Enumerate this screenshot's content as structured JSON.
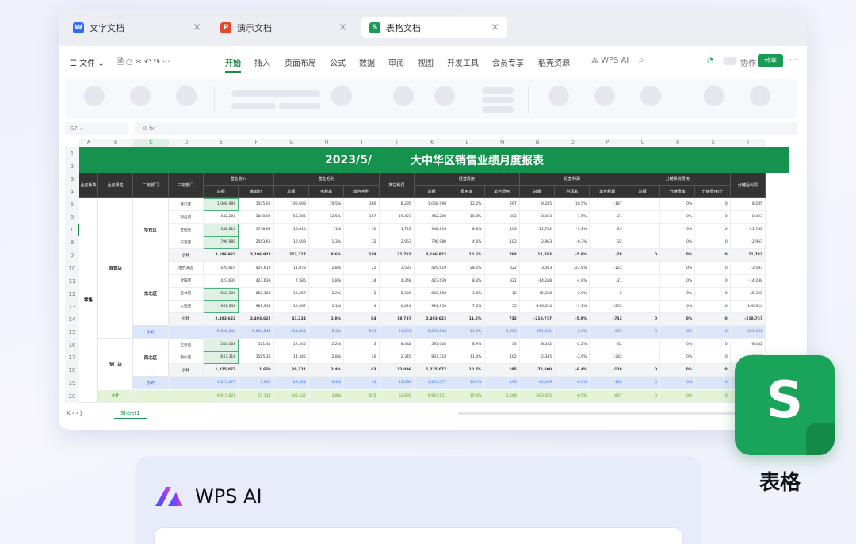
{
  "tabs": [
    {
      "icon": "W",
      "label": "文字文档",
      "color": "#2f6ef5"
    },
    {
      "icon": "P",
      "label": "演示文档",
      "color": "#e5472a"
    },
    {
      "icon": "S",
      "label": "表格文档",
      "color": "#1a9a55"
    }
  ],
  "toolbar": {
    "file": "☰ 文件 ⌄",
    "quick": "🗎  ⎙  ✂  ↶  ↷  ···",
    "menus": [
      "开始",
      "插入",
      "页面布局",
      "公式",
      "数据",
      "审阅",
      "视图",
      "开发工具",
      "会员专享",
      "稻壳资源"
    ],
    "wps_ai": "⟁ WPS AI",
    "collab": "协作",
    "share": "分享"
  },
  "formula_bar": {
    "name_box": "G7  ⌄",
    "fx": "⊖  fx"
  },
  "columns": [
    "A",
    "B",
    "C",
    "D",
    "E",
    "F",
    "G",
    "H",
    "I",
    "J",
    "K",
    "L",
    "M",
    "N",
    "O",
    "P",
    "Q",
    "R",
    "S",
    "T"
  ],
  "rows": [
    "1",
    "2",
    "3",
    "4",
    "5",
    "6",
    "7",
    "8",
    "9",
    "10",
    "11",
    "12",
    "13",
    "14",
    "15",
    "16",
    "17",
    "18",
    "19",
    "20"
  ],
  "report": {
    "date": "2023/5/",
    "title": "大中华区销售业绩月度报表",
    "headers_row3": [
      "业务板块",
      "业务属性",
      "二级部门",
      "三级部门",
      "营业收入",
      "营业毛利",
      "其它利润",
      "经营费用",
      "经营利润",
      "分摊系统费用",
      "分摊后利润"
    ],
    "headers_row4": [
      "总额",
      "客单价",
      "总额",
      "毛利率",
      "单台毛利",
      "总额",
      "费用率",
      "单台费用",
      "总额",
      "利润率",
      "单台利润",
      "总额",
      "分摊费率",
      "分摊费用/个"
    ],
    "segment": "零售",
    "attr1": "直营店",
    "attr2": "专门店",
    "dept_east": "华东区",
    "dept_northeast": "东北区",
    "dept_northwest": "西北区",
    "subtotal": "小计",
    "data_rows": [
      {
        "store": "厦门店",
        "v": [
          "1,008,998",
          "1505.00",
          "190,693",
          "19.5%",
          "300",
          "8,285",
          "1,008,998",
          "12.2%",
          "267",
          "8,285",
          "10.5%",
          "-187",
          "",
          "0%",
          "0",
          "8,285"
        ]
      },
      {
        "store": "南昌店",
        "v": [
          "442,208",
          "1848.09",
          "55,285",
          "12.5%",
          "167",
          "19,423",
          "442,208",
          "18.8%",
          "301",
          "-8,423",
          "-1.5%",
          "-21",
          "",
          "0%",
          "0",
          "-8,423"
        ]
      },
      {
        "store": "合肥店",
        "v": [
          "348,816",
          "1748.69",
          "10,614",
          "11%",
          "30",
          "1,722",
          "348,816",
          "8.8%",
          "103",
          "-21,742",
          "-3.1%",
          "-23",
          "",
          "0%",
          "0",
          "-21,742"
        ]
      },
      {
        "store": "宁波店",
        "v": [
          "796,980",
          "2563.60",
          "10,509",
          "1.3%",
          "32",
          "2,963",
          "796,980",
          "4.6%",
          "102",
          "-2,963",
          "-0.3%",
          "-32",
          "",
          "0%",
          "0",
          "-2,963"
        ]
      },
      {
        "store": "小计",
        "v": [
          "3,196,922",
          "3,196,922",
          "273,717",
          "8.6%",
          "519",
          "31,783",
          "3,196,922",
          "10.6%",
          "764",
          "11,783",
          "-5.6%",
          "-78",
          "0",
          "0%",
          "0",
          "11,783"
        ]
      },
      {
        "store": "哈尔滨店",
        "v": [
          "429,619",
          "429,619",
          "11,873",
          "2.8%",
          "22",
          "3,583",
          "429,619",
          "28.2%",
          "322",
          "-3,583",
          "-22.8%",
          "-122",
          "",
          "0%",
          "0",
          "-3,583"
        ]
      },
      {
        "store": "沈阳店",
        "v": [
          "423,639",
          "423,639",
          "7,585",
          "1.8%",
          "34",
          "4,248",
          "423,639",
          "8.3%",
          "321",
          "-14,248",
          "-4.8%",
          "-21",
          "",
          "0%",
          "0",
          "-14,248"
        ]
      },
      {
        "store": "吉林店",
        "v": [
          "858,108",
          "858,108",
          "10,257",
          "2.2%",
          "2",
          "5,328",
          "858,108",
          "3.8%",
          "12",
          "-45,328",
          "-2.0%",
          "-2",
          "",
          "0%",
          "0",
          "-45,328"
        ]
      },
      {
        "store": "大连店",
        "v": [
          "981,958",
          "981,958",
          "10,567",
          "1.1%",
          "4",
          "6,024",
          "981,958",
          "7.6%",
          "55",
          "-196,324",
          "-1.1%",
          "-255",
          "",
          "0%",
          "0",
          "-196,324"
        ]
      },
      {
        "store": "小计",
        "v": [
          "2,493,622",
          "2,493,622",
          "43,234",
          "1.8%",
          "84",
          "18,737",
          "2,493,622",
          "11.5%",
          "732",
          "-219,737",
          "-5.9%",
          "-732",
          "0",
          "0%",
          "0",
          "-219,737"
        ]
      },
      {
        "store": "小计",
        "v": [
          "5,690,544",
          "5,690,544",
          "321,821",
          "5.3%",
          "593",
          "51,521",
          "5,690,544",
          "11.0%",
          "1,963",
          "-251,321",
          "-2.0%",
          "-963",
          "0",
          "0%",
          "0",
          "-251,321"
        ]
      },
      {
        "store": "兰州店",
        "v": [
          "583,008",
          "521.44",
          "12,345",
          "2.2%",
          "3",
          "8,432",
          "583,008",
          "8.9%",
          "33",
          "-8,432",
          "-2.2%",
          "-32",
          "",
          "0%",
          "0",
          "-8,432"
        ]
      },
      {
        "store": "银川店",
        "v": [
          "837,318",
          "1585.36",
          "14,345",
          "2.8%",
          "40",
          "2,345",
          "837,318",
          "11.4%",
          "162",
          "-2,345",
          "-2.6%",
          "-382",
          "",
          "0%",
          "0",
          "-2,345"
        ]
      },
      {
        "store": "小计",
        "v": [
          "1,225,077",
          "1,650",
          "29,321",
          "2.4%",
          "43",
          "12,096",
          "1,225,077",
          "10.7%",
          "195",
          "-72,000",
          "-6.4%",
          "-128",
          "0",
          "0%",
          "0",
          "-72,000"
        ]
      },
      {
        "store": "小计",
        "v": [
          "1,225,077",
          "1,650",
          "29,321",
          "2.4%",
          "43",
          "12,096",
          "1,225,077",
          "10.7%",
          "195",
          "-42,099",
          "-6.4%",
          "-128",
          "0",
          "0%",
          "0",
          "-42,099"
        ]
      },
      {
        "store": "小计",
        "v": [
          "6,915,621",
          "15,114",
          "345,332",
          "3.8%",
          "635",
          "63,693",
          "6,915,621",
          "10.9%",
          "1,268",
          "-293,055",
          "-8.5%",
          "-867",
          "0",
          "0%",
          "0",
          "-293,055"
        ]
      }
    ]
  },
  "sheet_tab": "Sheet1",
  "nav_arrows": "K  ‹  ›  ⟫",
  "app_card": {
    "letter": "S",
    "name": "表格"
  },
  "ai_panel": {
    "title": "WPS AI"
  }
}
